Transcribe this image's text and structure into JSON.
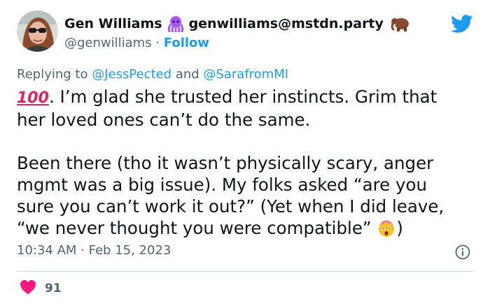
{
  "author": {
    "display_name": "Gen Williams",
    "mastodon_handle": "genwilliams@mstdn.party",
    "handle": "@genwilliams",
    "separator": "·",
    "follow_label": "Follow"
  },
  "reply": {
    "prefix": "Replying to",
    "mention1": "@JessPected",
    "conjunction": "and",
    "mention2": "@SarafromMI"
  },
  "tweet": {
    "emoji_100": "100",
    "line1": ". I’m glad she trusted her instincts. Grim that her loved ones can’t do the same.",
    "line2": "Been there (tho it wasn’t physically scary, anger mgmt was a big issue). My folks asked “are you sure you can’t work it out?” (Yet when I did leave, “we never thought you were compatible”",
    "line2_end": ")"
  },
  "meta": {
    "timestamp": "10:34 AM · Feb 15, 2023"
  },
  "stats": {
    "likes": "91"
  },
  "colors": {
    "brand_blue": "#1d9bf0",
    "muted_text": "#536471",
    "like_red": "#f91880",
    "octopus_purple": "#a855f7"
  },
  "icons": [
    "avatar",
    "octopus-emoji",
    "mammoth-emoji",
    "twitter-bird-icon",
    "hundred-points-emoji",
    "shocked-face-emoji",
    "info-icon",
    "heart-icon"
  ]
}
